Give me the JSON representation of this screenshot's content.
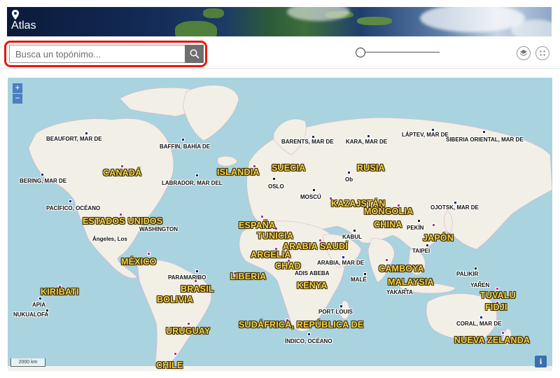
{
  "header": {
    "title": "Atlas",
    "pin_icon": "map-pin-icon"
  },
  "search": {
    "placeholder": "Busca un topónimo...",
    "button_icon": "search-icon"
  },
  "toolbar": {
    "layers_icon": "layers-icon",
    "fullscreen_icon": "fullscreen-icon",
    "slider_value": 0
  },
  "map_controls": {
    "zoom_in": "+",
    "zoom_out": "−",
    "scale_text": "2000 km",
    "info": "i"
  },
  "colors": {
    "accent": "#e8160c",
    "marker_sea": "#142a8a",
    "marker_country": "#b2338f",
    "marker_city": "#222222",
    "country_label": "#f5d24a"
  },
  "places": {
    "canada": "CANADÁ",
    "estados_unidos": "ESTADOS UNIDOS",
    "mexico": "MÉXICO",
    "islandia": "ISLANDIA",
    "suecia": "SUECIA",
    "rusia": "RUSIA",
    "kazajstan": "KAZAJSTÁN",
    "mongolia": "MONGOLIA",
    "china": "CHINA",
    "japon": "JAPÓN",
    "espana": "ESPAÑA",
    "tunicia": "TUNICIA",
    "argelia": "ARGELIA",
    "arabia_saudi": "ARABIA SAUDÍ",
    "chad": "CHAD",
    "liberia": "LIBERIA",
    "kenya": "KENYA",
    "camboya": "CAMBOYA",
    "malaysia": "MALAYSIA",
    "tuvalu": "TUVALU",
    "fidji": "FIDJI",
    "kiribati": "KIRIBATI",
    "brasil": "BRASIL",
    "bolivia": "BOLIVIA",
    "uruguay": "URUGUAY",
    "chile": "CHILE",
    "sudafrica": "SUDÁFRICA, REPÚBLICA DE",
    "nueva_zelanda": "NUEVA ZELANDA",
    "beaufort": "BEAUFORT, MAR DE",
    "baffin": "BAFFIN, BAHÍA DE",
    "barents": "BARENTS, MAR DE",
    "kara": "KARA, MAR DE",
    "laptev": "LÁPTEV, MAR DE",
    "siberia": "SIBERIA ORIENTAL, MAR DE",
    "bering": "BERING, MAR DE",
    "labrador": "LABRADOR, MAR DEL",
    "ob": "Ob",
    "oslo": "OSLO",
    "moscu": "MOSCÚ",
    "pacifico": "PACÍFICO, OCÉANO",
    "ojotsk": "OJOTSK, MAR DE",
    "washington": "WASHINGTON",
    "angeles": "Ángeles, Los",
    "pekin": "PEKÍN",
    "kabul": "KABUL",
    "taipei": "TAIPEI",
    "adis_abeba": "ADIS ABEBA",
    "arabia_mar": "ARABIA, MAR DE",
    "paramaribo": "PARAMARIBO",
    "male": "MALÉ",
    "palikir": "PALIKIR",
    "yaren": "YAREN",
    "yakarta": "YAKARTA",
    "apia": "APIA",
    "nukualofa": "NUKUALOFA",
    "port_louis": "PORT LOUIS",
    "coral": "CORAL, MAR DE",
    "indico": "ÍNDICO, OCÉANO"
  }
}
